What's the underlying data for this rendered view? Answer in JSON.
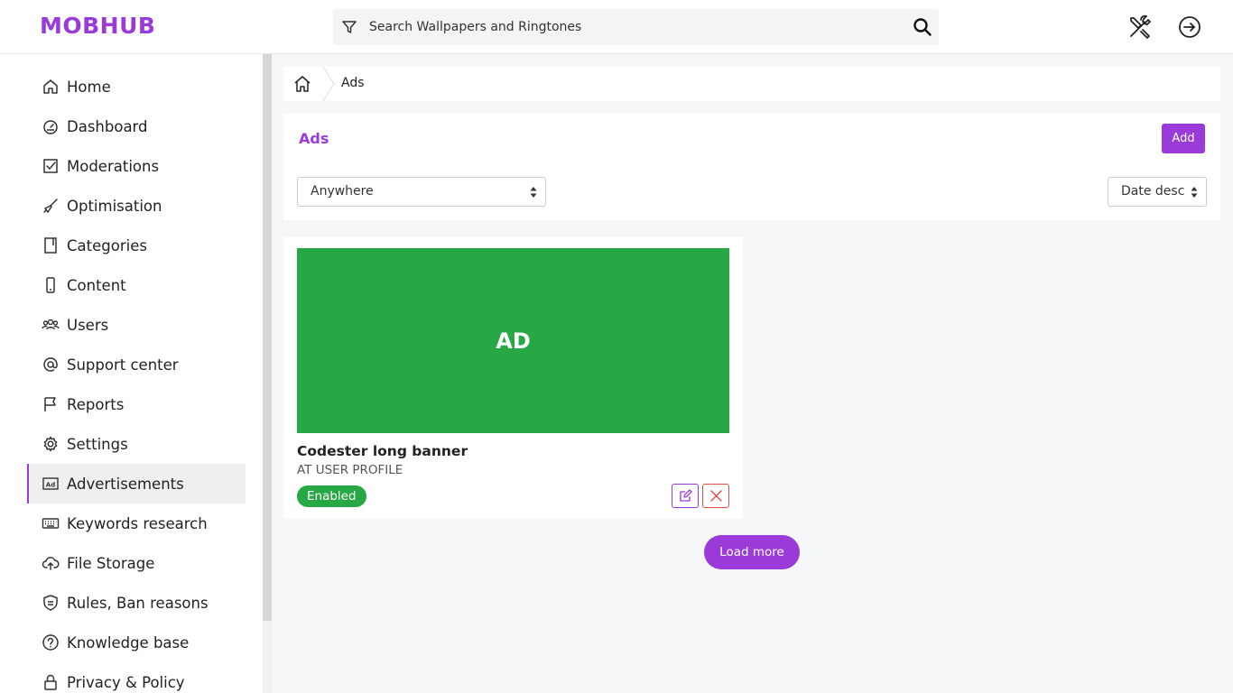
{
  "header": {
    "logo": "MOBHUB",
    "search_placeholder": "Search Wallpapers and Ringtones"
  },
  "sidebar": {
    "items": [
      {
        "label": "Home",
        "icon": "home-icon"
      },
      {
        "label": "Dashboard",
        "icon": "gauge-icon"
      },
      {
        "label": "Moderations",
        "icon": "check-square-icon"
      },
      {
        "label": "Optimisation",
        "icon": "broom-icon"
      },
      {
        "label": "Categories",
        "icon": "book-icon"
      },
      {
        "label": "Content",
        "icon": "phone-icon"
      },
      {
        "label": "Users",
        "icon": "users-icon"
      },
      {
        "label": "Support center",
        "icon": "at-icon"
      },
      {
        "label": "Reports",
        "icon": "flag-icon"
      },
      {
        "label": "Settings",
        "icon": "gear-icon"
      },
      {
        "label": "Advertisements",
        "icon": "ad-icon"
      },
      {
        "label": "Keywords research",
        "icon": "keyboard-icon"
      },
      {
        "label": "File Storage",
        "icon": "cloud-upload-icon"
      },
      {
        "label": "Rules, Ban reasons",
        "icon": "shield-icon"
      },
      {
        "label": "Knowledge base",
        "icon": "question-circle-icon"
      },
      {
        "label": "Privacy & Policy",
        "icon": "lock-icon"
      }
    ],
    "active": "Advertisements"
  },
  "breadcrumb": {
    "current": "Ads"
  },
  "panel": {
    "title": "Ads",
    "add_label": "Add",
    "location_filter": "Anywhere",
    "sort": "Date desc"
  },
  "card": {
    "preview_text": "AD",
    "title": "Codester long banner",
    "subtitle": "AT USER PROFILE",
    "status": "Enabled"
  },
  "load_more_label": "Load more",
  "colors": {
    "accent": "#9a3bd9",
    "success": "#28a745",
    "danger": "#e04b4b"
  }
}
